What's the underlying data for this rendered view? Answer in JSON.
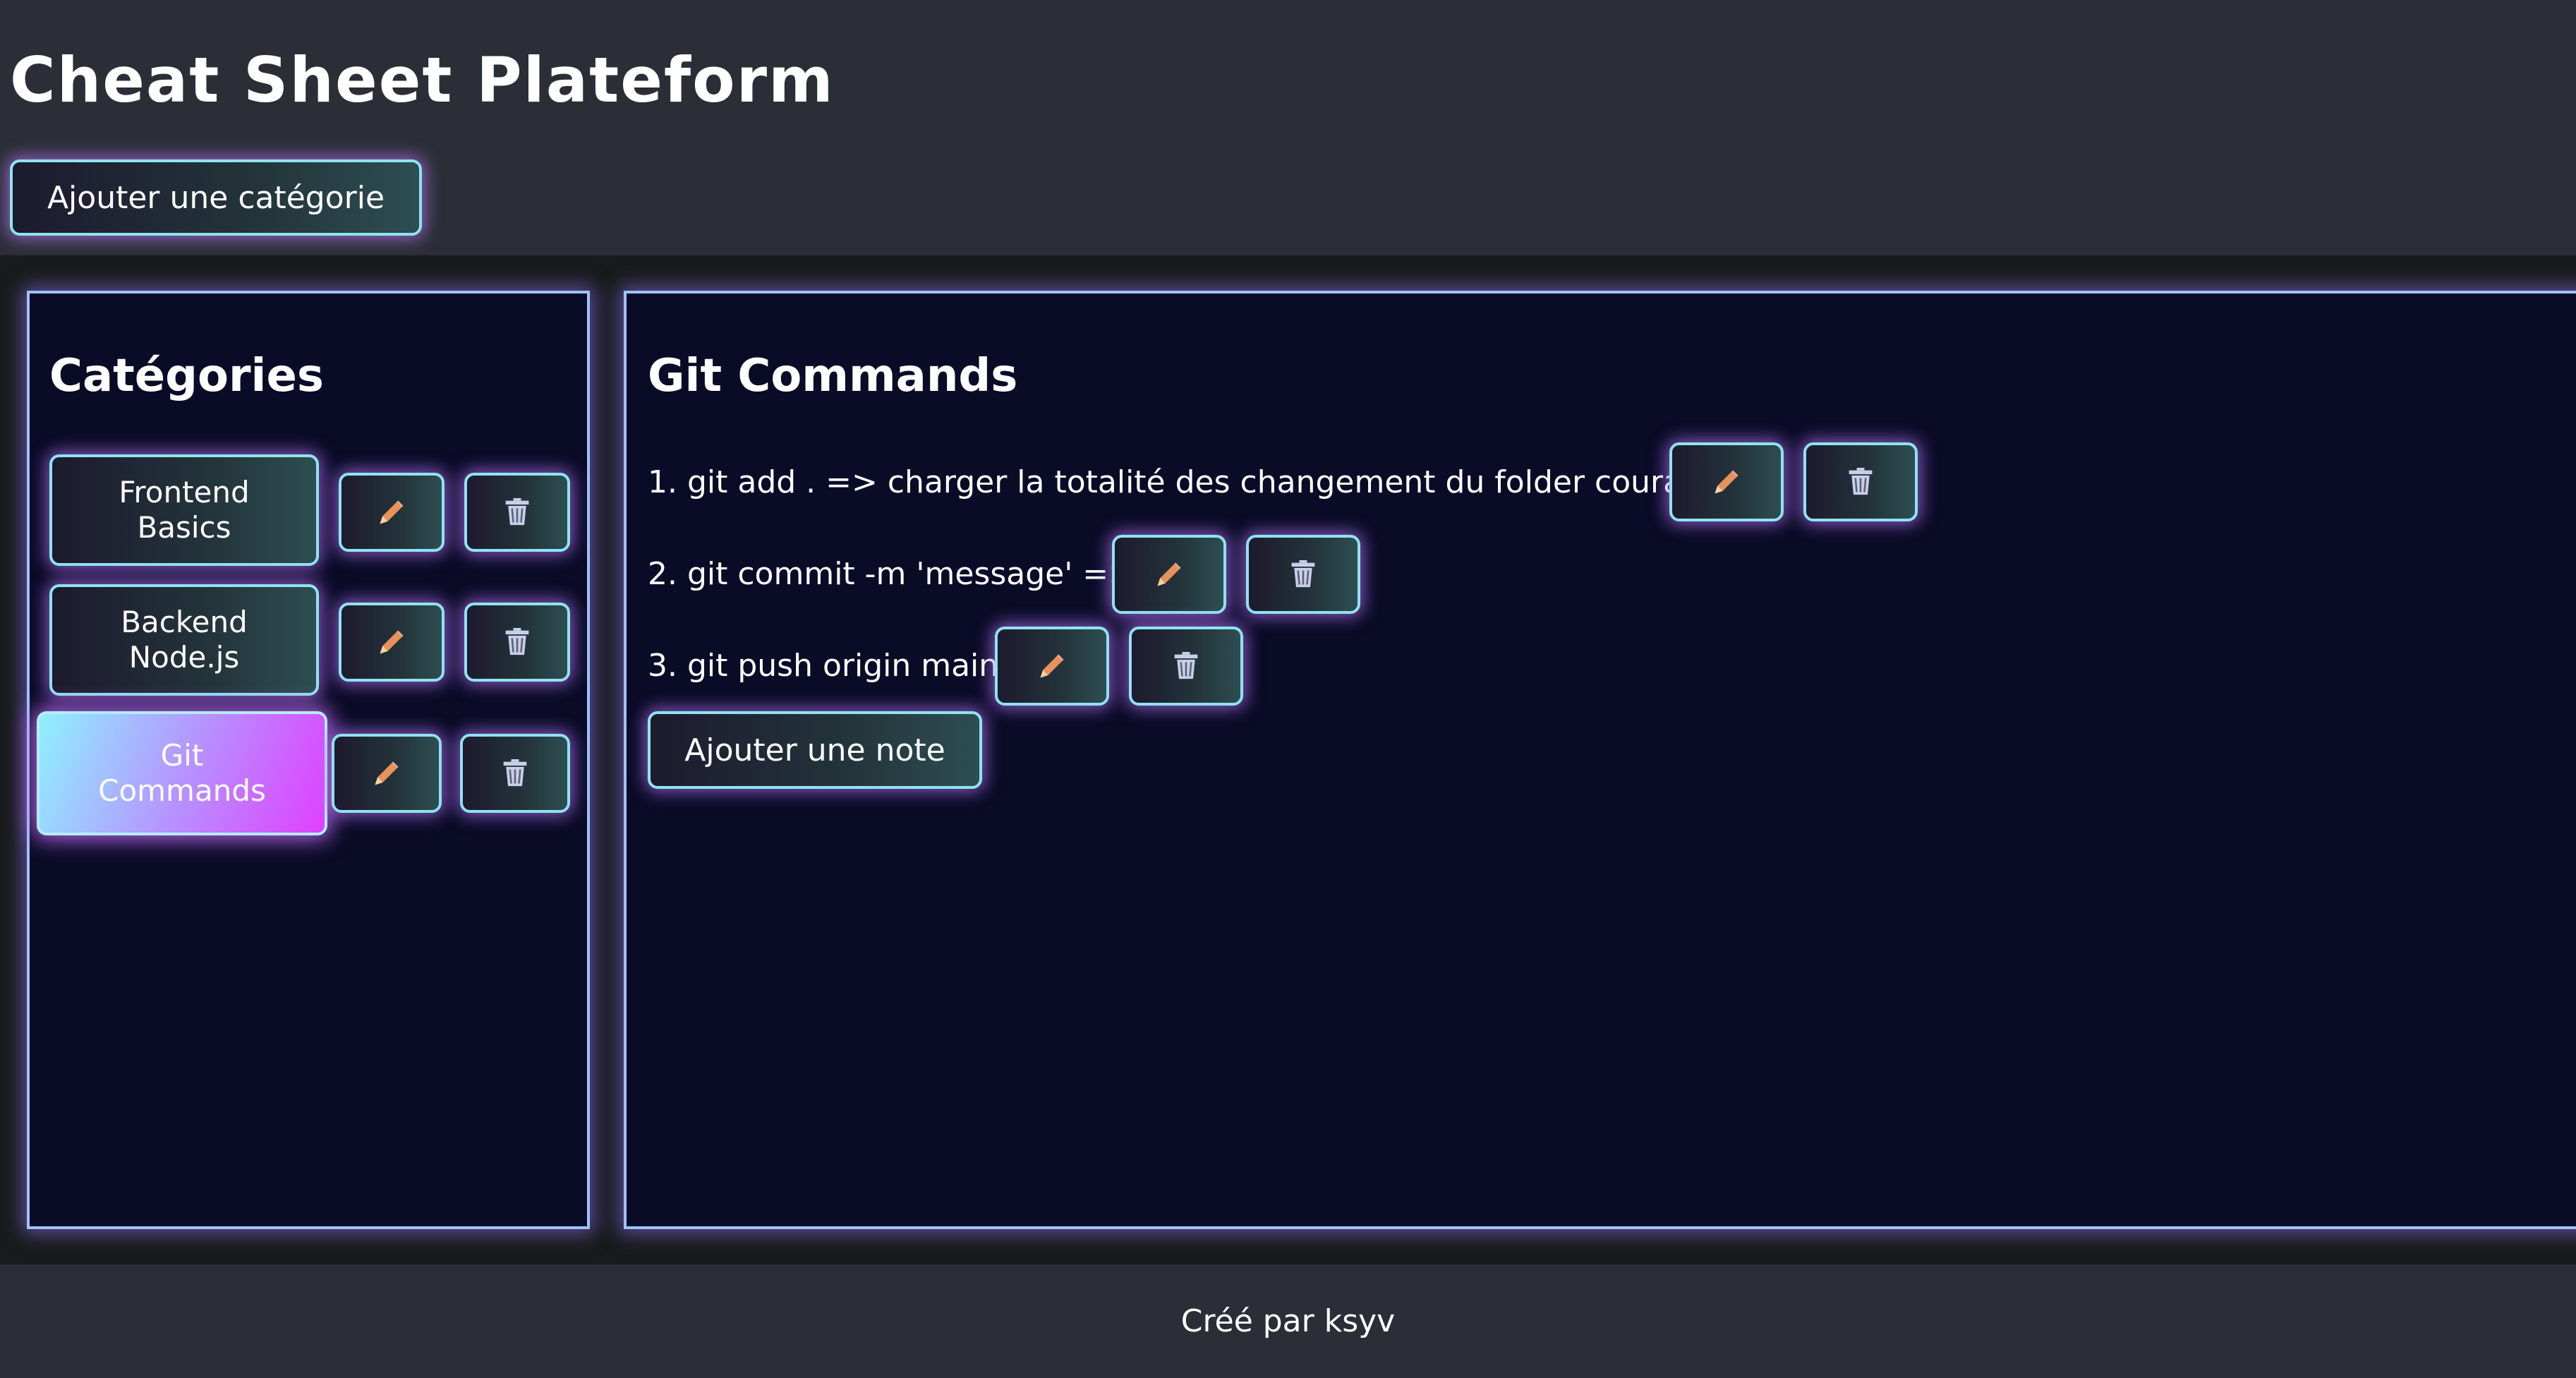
{
  "header": {
    "title": "Cheat Sheet Plateform",
    "add_category_label": "Ajouter une catégorie"
  },
  "sidebar": {
    "heading": "Catégories",
    "categories": [
      {
        "line1": "Frontend",
        "line2": "Basics",
        "active": false
      },
      {
        "line1": "Backend",
        "line2": "Node.js",
        "active": false
      },
      {
        "line1": "Git",
        "line2": "Commands",
        "active": true
      }
    ],
    "edit_icon": "pencil-icon",
    "delete_icon": "trash-icon"
  },
  "content": {
    "heading": "Git Commands",
    "notes": [
      "1. git add . => charger la totalité des changement du folder courant",
      "2. git commit -m 'message' =>",
      "3. git push origin main"
    ],
    "add_note_label": "Ajouter une note"
  },
  "footer": {
    "text": "Créé par ksyv"
  },
  "colors": {
    "header_bg": "#2b2e36",
    "panel_bg": "#0a0b26",
    "panel_border": "#9ec2ff",
    "button_border": "#8fe3f0",
    "glow": "#ba78ff",
    "active_gradient_start": "#8ff0ff",
    "active_gradient_end": "#e040ff"
  }
}
